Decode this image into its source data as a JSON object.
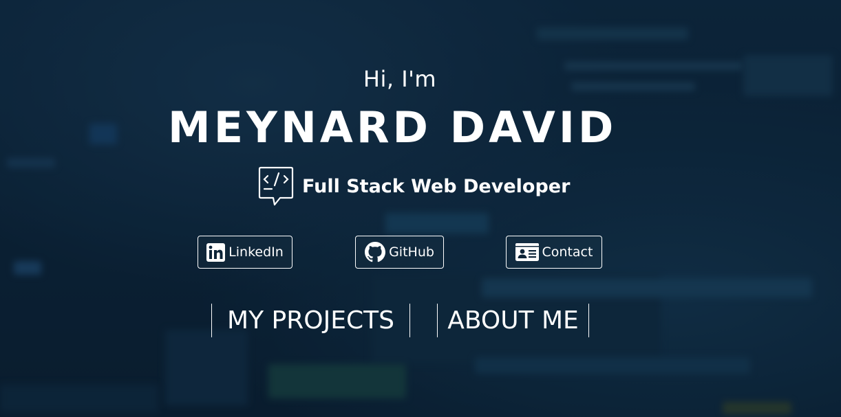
{
  "hero": {
    "greeting": "Hi, I'm",
    "name": "MEYNARD DAVID",
    "role": "Full Stack Web Developer",
    "role_icon": "code-chat-icon"
  },
  "social": [
    {
      "label": "LinkedIn",
      "icon": "linkedin-icon"
    },
    {
      "label": "GitHub",
      "icon": "github-icon"
    },
    {
      "label": "Contact",
      "icon": "contact-card-icon"
    }
  ],
  "nav": [
    {
      "label": "MY PROJECTS"
    },
    {
      "label": "ABOUT ME"
    }
  ],
  "colors": {
    "background": "#0d2438",
    "text": "#ffffff",
    "border": "#ffffff"
  }
}
